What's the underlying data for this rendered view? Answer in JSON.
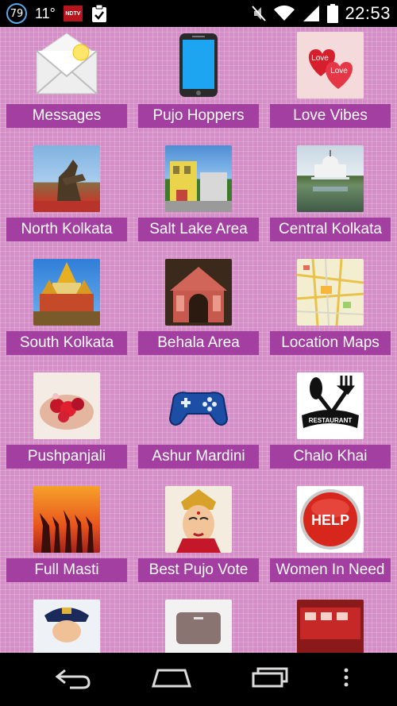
{
  "status_bar": {
    "notification_count": "79",
    "temperature": "11°",
    "news_app_label": "NDTV",
    "time": "22:53"
  },
  "tiles": [
    {
      "label": "Messages",
      "icon": "envelope-icon"
    },
    {
      "label": "Pujo Hoppers",
      "icon": "phone-icon"
    },
    {
      "label": "Love Vibes",
      "icon": "hearts-icon",
      "image_text": "Love"
    },
    {
      "label": "North Kolkata",
      "icon": "statue-photo"
    },
    {
      "label": "Salt Lake Area",
      "icon": "building-photo"
    },
    {
      "label": "Central Kolkata",
      "icon": "memorial-photo"
    },
    {
      "label": "South Kolkata",
      "icon": "temple-photo"
    },
    {
      "label": "Behala Area",
      "icon": "pandal-photo"
    },
    {
      "label": "Location Maps",
      "icon": "map-photo"
    },
    {
      "label": "Pushpanjali",
      "icon": "flowers-photo"
    },
    {
      "label": "Ashur Mardini",
      "icon": "gamepad-icon"
    },
    {
      "label": "Chalo Khai",
      "icon": "restaurant-icon",
      "image_text": "RESTAURANT"
    },
    {
      "label": "Full Masti",
      "icon": "dancers-photo"
    },
    {
      "label": "Best Pujo Vote",
      "icon": "durga-photo"
    },
    {
      "label": "Women In Need",
      "icon": "help-button-icon",
      "image_text": "HELP"
    },
    {
      "label": "",
      "icon": "police-photo"
    },
    {
      "label": "",
      "icon": "box-photo"
    },
    {
      "label": "",
      "icon": "firetruck-photo"
    }
  ]
}
